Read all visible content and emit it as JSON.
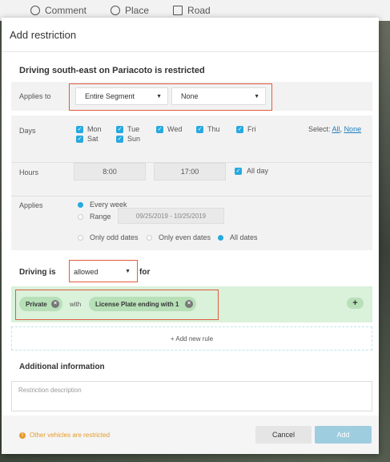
{
  "topbar": {
    "items": [
      {
        "label": "Comment",
        "icon": "comment-icon"
      },
      {
        "label": "Place",
        "icon": "place-icon"
      },
      {
        "label": "Road",
        "icon": "road-icon"
      }
    ]
  },
  "dialog": {
    "title": "Add restriction",
    "headline": "Driving south-east on Pariacoto is restricted"
  },
  "applies_to": {
    "label": "Applies to",
    "segment_value": "Entire Segment",
    "lane_value": "None"
  },
  "days": {
    "label": "Days",
    "items": [
      "Mon",
      "Tue",
      "Wed",
      "Thu",
      "Fri",
      "Sat",
      "Sun"
    ],
    "select_label": "Select:",
    "select_all": "All",
    "select_none": "None"
  },
  "hours": {
    "label": "Hours",
    "from": "8:00",
    "to": "17:00",
    "all_day": "All day"
  },
  "applies": {
    "label": "Applies",
    "every_week": "Every week",
    "range": "Range",
    "range_value": "09/25/2019 - 10/25/2019",
    "odd": "Only odd dates",
    "even": "Only even dates",
    "all": "All dates"
  },
  "driving": {
    "label": "Driving is",
    "value": "allowed",
    "for": "for"
  },
  "rule": {
    "chip1": "Private",
    "with": "with",
    "chip2": "License Plate ending with 1",
    "plus": "+"
  },
  "add_rule": "+ Add new rule",
  "additional": {
    "title": "Additional information",
    "placeholder": "Restriction description"
  },
  "footer": {
    "warning": "Other vehicles are restricted",
    "cancel": "Cancel",
    "add": "Add"
  },
  "colors": {
    "accent": "#26a9e0",
    "highlight": "#e05b3f",
    "rule_bg": "#daf1da",
    "warning": "#e69a2b",
    "add_button": "#9fcde0"
  }
}
